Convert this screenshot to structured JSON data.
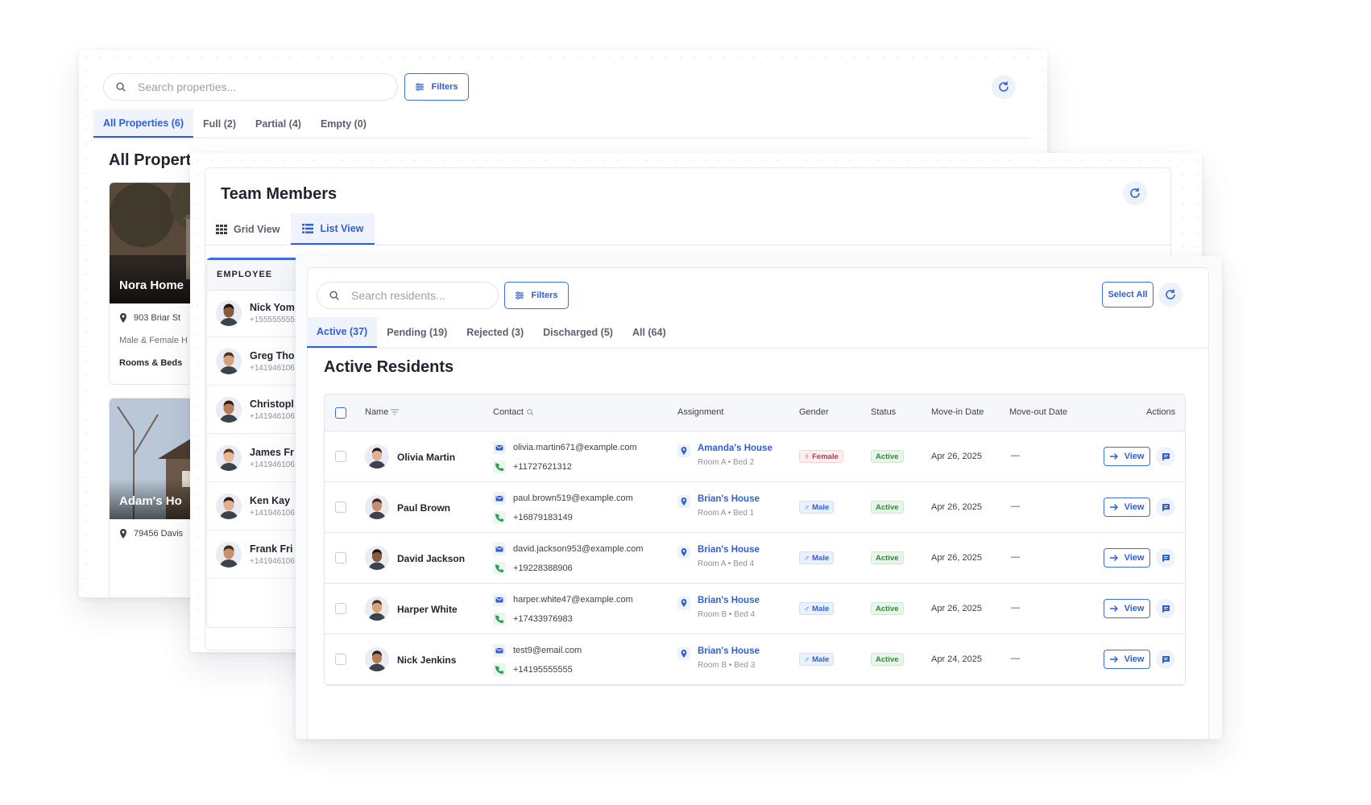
{
  "properties": {
    "search_placeholder": "Search properties...",
    "filters_label": "Filters",
    "tabs": [
      "All Properties (6)",
      "Full (2)",
      "Partial (4)",
      "Empty (0)"
    ],
    "heading": "All Propert",
    "cards": [
      {
        "name": "Nora Home",
        "address": "903 Briar St",
        "gender": "Male & Female H",
        "rooms_label": "Rooms & Beds"
      },
      {
        "name": "Adam's Ho",
        "address": "79456 Davis"
      }
    ]
  },
  "team": {
    "title": "Team Members",
    "grid_view": "Grid View",
    "list_view": "List View",
    "column": "EMPLOYEE",
    "members": [
      {
        "name": "Nick Yom",
        "phone": "+155555555"
      },
      {
        "name": "Greg Tho",
        "phone": "+141946106"
      },
      {
        "name": "Christopl",
        "phone": "+141946106"
      },
      {
        "name": "James Fr",
        "phone": "+141946106"
      },
      {
        "name": "Ken Kay",
        "phone": "+141946106"
      },
      {
        "name": "Frank Fri",
        "phone": "+141946106"
      }
    ]
  },
  "residents": {
    "search_placeholder": "Search residents...",
    "filters_label": "Filters",
    "select_all": "Select All",
    "tabs": [
      "Active (37)",
      "Pending (19)",
      "Rejected (3)",
      "Discharged (5)",
      "All (64)"
    ],
    "heading": "Active Residents",
    "columns": {
      "name": "Name",
      "contact": "Contact",
      "assignment": "Assignment",
      "gender": "Gender",
      "status": "Status",
      "move_in": "Move-in Date",
      "move_out": "Move-out Date",
      "actions": "Actions"
    },
    "view_label": "View",
    "rows": [
      {
        "name": "Olivia Martin",
        "email": "olivia.martin671@example.com",
        "phone": "+11727621312",
        "house": "Amanda's House",
        "room": "Room A • Bed 2",
        "gender": "Female",
        "status": "Active",
        "move_in": "Apr 26, 2025",
        "move_out": "—"
      },
      {
        "name": "Paul Brown",
        "email": "paul.brown519@example.com",
        "phone": "+16879183149",
        "house": "Brian's House",
        "room": "Room A • Bed 1",
        "gender": "Male",
        "status": "Active",
        "move_in": "Apr 26, 2025",
        "move_out": "—"
      },
      {
        "name": "David Jackson",
        "email": "david.jackson953@example.com",
        "phone": "+19228388906",
        "house": "Brian's House",
        "room": "Room A • Bed 4",
        "gender": "Male",
        "status": "Active",
        "move_in": "Apr 26, 2025",
        "move_out": "—"
      },
      {
        "name": "Harper White",
        "email": "harper.white47@example.com",
        "phone": "+17433976983",
        "house": "Brian's House",
        "room": "Room B • Bed 4",
        "gender": "Male",
        "status": "Active",
        "move_in": "Apr 26, 2025",
        "move_out": "—"
      },
      {
        "name": "Nick Jenkins",
        "email": "test9@email.com",
        "phone": "+14195555555",
        "house": "Brian's House",
        "room": "Room B • Bed 3",
        "gender": "Male",
        "status": "Active",
        "move_in": "Apr 24, 2025",
        "move_out": "—"
      }
    ]
  },
  "colors": {
    "accent": "#2f5fd6",
    "female": "#d0314b",
    "active": "#2b8a3e"
  }
}
